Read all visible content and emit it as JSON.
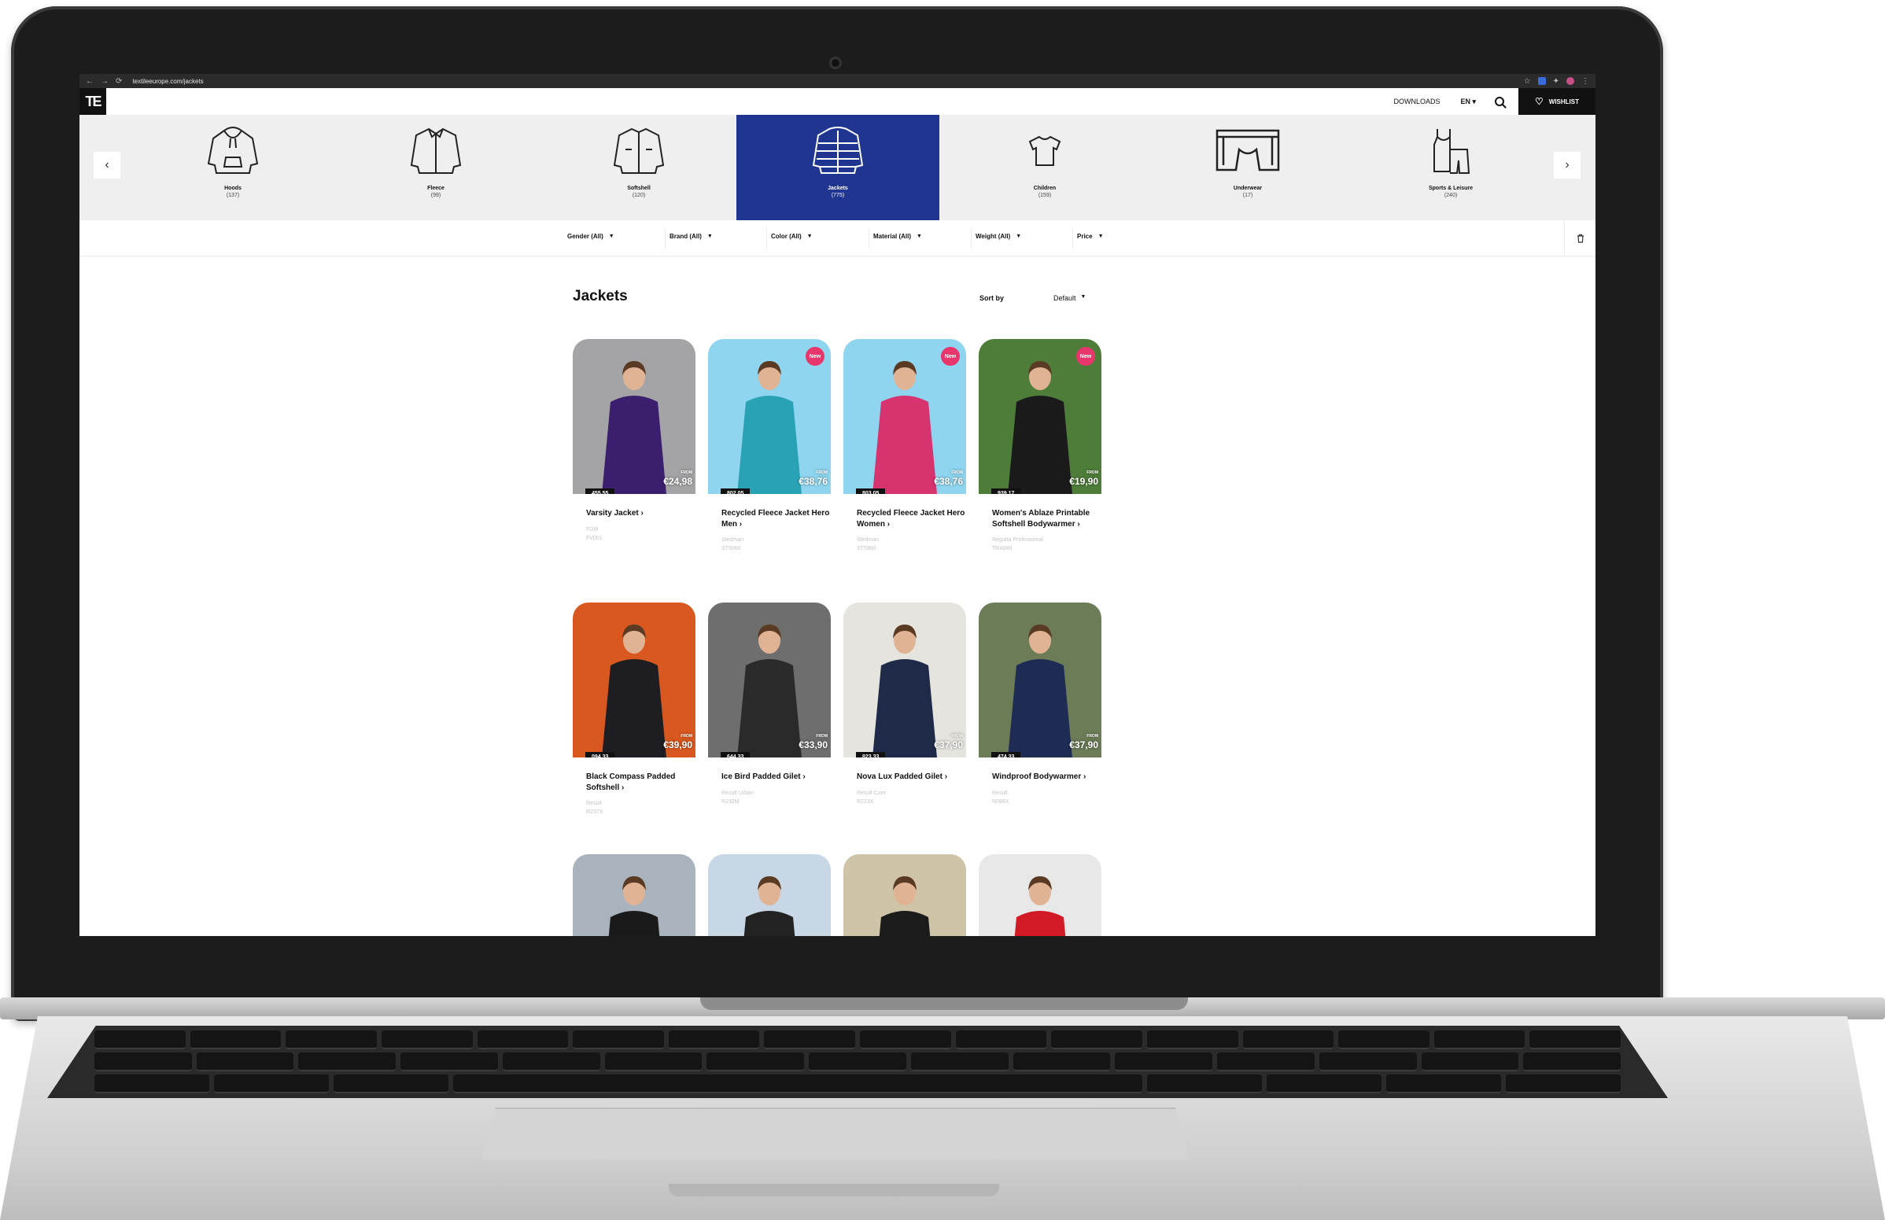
{
  "browser": {
    "nav_back": "←",
    "nav_forward": "→",
    "nav_reload": "⟳",
    "url": "textileeurope.com/jackets"
  },
  "header": {
    "logo": "TE",
    "downloads": "DOWNLOADS",
    "language": "EN ▾",
    "wishlist": "WISHLIST"
  },
  "categories": [
    {
      "label": "Hoods",
      "count": "(137)",
      "icon": "hoodie-icon"
    },
    {
      "label": "Fleece",
      "count": "(99)",
      "icon": "fleece-icon"
    },
    {
      "label": "Softshell",
      "count": "(120)",
      "icon": "softshell-icon"
    },
    {
      "label": "Jackets",
      "count": "(775)",
      "icon": "jacket-icon",
      "active": true
    },
    {
      "label": "Children",
      "count": "(159)",
      "icon": "tshirt-icon"
    },
    {
      "label": "Underwear",
      "count": "(17)",
      "icon": "underwear-icon"
    },
    {
      "label": "Sports & Leisure",
      "count": "(240)",
      "icon": "sports-icon"
    }
  ],
  "filters": [
    {
      "label": "Gender (All)"
    },
    {
      "label": "Brand (All)"
    },
    {
      "label": "Color (All)"
    },
    {
      "label": "Material (All)"
    },
    {
      "label": "Weight (All)"
    },
    {
      "label": "Price"
    }
  ],
  "listing": {
    "title": "Jackets",
    "sort_label": "Sort by",
    "sort_value": "Default"
  },
  "products": [
    {
      "name": "Varsity Jacket",
      "code_tag": "455.55",
      "price_from": "FROM",
      "price": "€24,98",
      "brand": "FDM",
      "sku": "FV001",
      "new": false,
      "bg": "#a4a4a6",
      "garment": "#3b1f6e"
    },
    {
      "name": "Recycled Fleece Jacket Hero Men",
      "code_tag": "802.05",
      "price_from": "FROM",
      "price": "€38,76",
      "brand": "Stedman",
      "sku": "ST5060",
      "new": true,
      "new_label": "New",
      "bg": "#8fd5ef",
      "garment": "#2aa2b6"
    },
    {
      "name": "Recycled Fleece Jacket Hero Women",
      "code_tag": "803.05",
      "price_from": "FROM",
      "price": "€38,76",
      "brand": "Stedman",
      "sku": "ST5960",
      "new": true,
      "new_label": "New",
      "bg": "#8fd5ef",
      "garment": "#d6336f"
    },
    {
      "name": "Women's Ablaze Printable Softshell Bodywarmer",
      "code_tag": "939.17",
      "price_from": "FROM",
      "price": "€19,90",
      "brand": "Regatta Professional",
      "sku": "TRA845",
      "new": true,
      "new_label": "New",
      "bg": "#4e7d3a",
      "garment": "#1a1a1a"
    },
    {
      "name": "Black Compass Padded Softshell",
      "code_tag": "094.33",
      "price_from": "FROM",
      "price": "€39,90",
      "brand": "Result",
      "sku": "R237X",
      "new": false,
      "bg": "#d9581f",
      "garment": "#1e1e22"
    },
    {
      "name": "Ice Bird Padded Gilet",
      "code_tag": "644.33",
      "price_from": "FROM",
      "price": "€33,90",
      "brand": "Result Urban",
      "sku": "R192M",
      "new": false,
      "bg": "#6e6e6e",
      "garment": "#2a2a2a"
    },
    {
      "name": "Nova Lux Padded Gilet",
      "code_tag": "823.33",
      "price_from": "FROM",
      "price": "€37,90",
      "brand": "Result Core",
      "sku": "R223X",
      "new": false,
      "bg": "#e6e4df",
      "garment": "#1f2a48"
    },
    {
      "name": "Windproof Bodywarmer",
      "code_tag": "474.33",
      "price_from": "FROM",
      "price": "€37,90",
      "brand": "Result",
      "sku": "R088X",
      "new": false,
      "bg": "#6b7c57",
      "garment": "#1d2b55"
    },
    {
      "name": "",
      "code_tag": "",
      "price_from": "",
      "price": "",
      "brand": "",
      "sku": "",
      "new": false,
      "bg": "#a9b3bd",
      "garment": "#1a1a1a"
    },
    {
      "name": "",
      "code_tag": "",
      "price_from": "",
      "price": "",
      "brand": "",
      "sku": "",
      "new": false,
      "bg": "#c8d7e6",
      "garment": "#222222"
    },
    {
      "name": "",
      "code_tag": "",
      "price_from": "",
      "price": "",
      "brand": "",
      "sku": "",
      "new": false,
      "bg": "#cfc3a8",
      "garment": "#1b1b1b"
    },
    {
      "name": "",
      "code_tag": "",
      "price_from": "",
      "price": "",
      "brand": "",
      "sku": "",
      "new": false,
      "bg": "#e8e8e8",
      "garment": "#d11a26"
    }
  ],
  "colors": {
    "accent": "#1f3590",
    "new_badge": "#e8356c",
    "header_dark": "#111111"
  }
}
